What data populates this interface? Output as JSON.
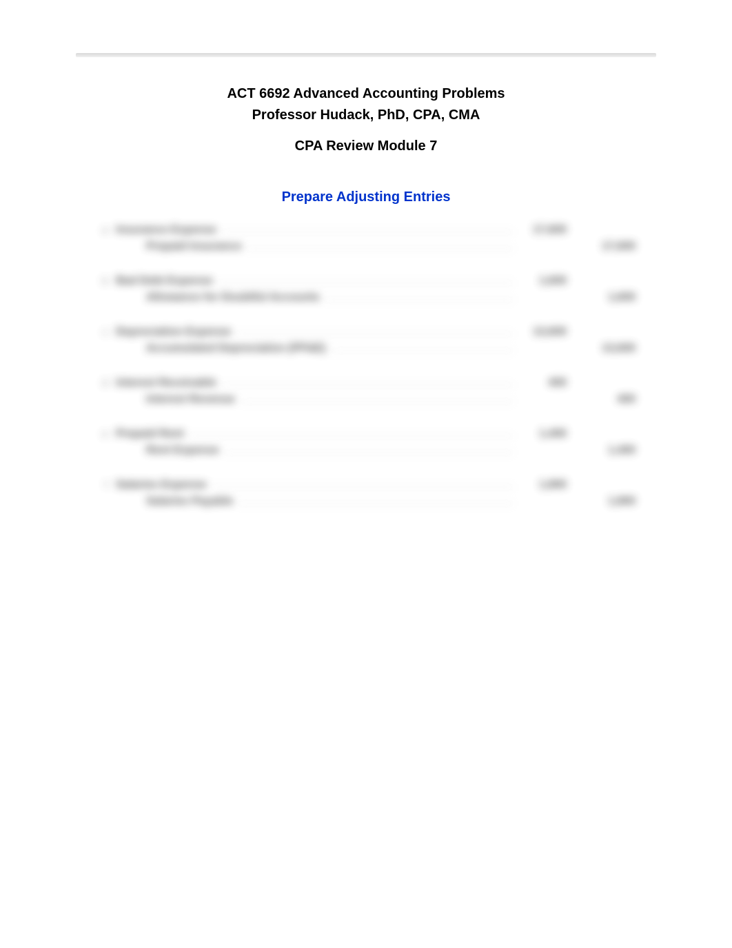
{
  "header": {
    "course_title": "ACT 6692 Advanced Accounting Problems",
    "professor": "Professor Hudack, PhD, CPA, CMA",
    "module": "CPA Review Module 7"
  },
  "section_title": "Prepare Adjusting Entries",
  "entries": [
    {
      "label": "a",
      "debit_account": "Insurance Expense",
      "debit_amount": "17,600",
      "credit_account": "Prepaid Insurance",
      "credit_amount": "17,600"
    },
    {
      "label": "b",
      "debit_account": "Bad Debt Expense",
      "debit_amount": "1,600",
      "credit_account": "Allowance for Doubtful Accounts",
      "credit_amount": "1,600"
    },
    {
      "label": "c",
      "debit_account": "Depreciation Expense",
      "debit_amount": "13,600",
      "credit_account": "Accumulated Depreciation (PP&E)",
      "credit_amount": "13,600"
    },
    {
      "label": "d",
      "debit_account": "Interest Receivable",
      "debit_amount": "400",
      "credit_account": "Interest Revenue",
      "credit_amount": "400"
    },
    {
      "label": "e",
      "debit_account": "Prepaid Rent",
      "debit_amount": "1,400",
      "credit_account": "Rent Expense",
      "credit_amount": "1,400"
    },
    {
      "label": "f",
      "debit_account": "Salaries Expense",
      "debit_amount": "1,800",
      "credit_account": "Salaries Payable",
      "credit_amount": "1,800"
    }
  ]
}
